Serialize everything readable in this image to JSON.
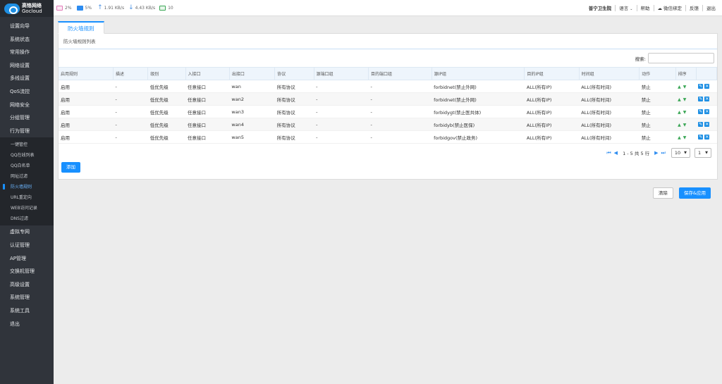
{
  "brand": {
    "name_cn": "高恪网络",
    "name_en": "Gocloud"
  },
  "sidebar": {
    "items_top": [
      {
        "label": "设置向导",
        "icon": "wizard-icon"
      },
      {
        "label": "系统状态",
        "icon": "status-icon"
      },
      {
        "label": "常用操作",
        "icon": "operations-icon"
      },
      {
        "label": "网络设置",
        "icon": "network-icon"
      },
      {
        "label": "多线设置",
        "icon": "multiline-icon"
      },
      {
        "label": "QoS流控",
        "icon": "qos-icon"
      },
      {
        "label": "网络安全",
        "icon": "security-icon"
      },
      {
        "label": "分组管理",
        "icon": "group-icon"
      },
      {
        "label": "行为管理",
        "icon": "behavior-icon"
      }
    ],
    "submenu": [
      {
        "label": "一键管控",
        "active": false
      },
      {
        "label": "QQ在线列表",
        "active": false
      },
      {
        "label": "QQ白名单",
        "active": false
      },
      {
        "label": "网址过滤",
        "active": false
      },
      {
        "label": "防火墙规则",
        "active": true
      },
      {
        "label": "URL重定向",
        "active": false
      },
      {
        "label": "WEB访问记录",
        "active": false
      },
      {
        "label": "DNS过滤",
        "active": false
      }
    ],
    "items_bottom": [
      {
        "label": "虚拟专网",
        "icon": "vpn-icon"
      },
      {
        "label": "认证管理",
        "icon": "auth-icon"
      },
      {
        "label": "AP管理",
        "icon": "ap-icon"
      },
      {
        "label": "交换机管理",
        "icon": "switch-icon"
      },
      {
        "label": "高级设置",
        "icon": "advanced-icon"
      },
      {
        "label": "系统管理",
        "icon": "system-icon"
      },
      {
        "label": "系统工具",
        "icon": "tools-icon"
      },
      {
        "label": "退出",
        "icon": "exit-icon"
      }
    ]
  },
  "topbar": {
    "cpu": "2%",
    "mem": "5%",
    "upload": "1.91 KB/s",
    "download": "4.43 KB/s",
    "devices": "10",
    "org": "普宁卫生院",
    "language": "语言",
    "help": "帮助",
    "wechat": "微信绑定",
    "feedback": "反馈",
    "logout": "退出"
  },
  "main": {
    "tab": "防火墙规则",
    "panel_title": "防火墙规则列表",
    "search_label": "搜索:",
    "search_placeholder": "",
    "columns": [
      "启用规则",
      "描述",
      "级别",
      "入接口",
      "出接口",
      "协议",
      "源端口组",
      "目的端口组",
      "源IP组",
      "目的IP组",
      "时间组",
      "动作",
      "排序",
      ""
    ],
    "rows": [
      {
        "enabled": "启用",
        "desc": "-",
        "level": "低优先级",
        "in": "任意接口",
        "out": "wan",
        "proto": "所有协议",
        "src_port": "-",
        "dst_port": "-",
        "src_ip": "forbidnet(禁止外网)",
        "dst_ip": "ALL(所有IP)",
        "time": "ALL(所有时间)",
        "action": "禁止"
      },
      {
        "enabled": "启用",
        "desc": "-",
        "level": "低优先级",
        "in": "任意接口",
        "out": "wan2",
        "proto": "所有协议",
        "src_port": "-",
        "dst_port": "-",
        "src_ip": "forbidnet(禁止外网)",
        "dst_ip": "ALL(所有IP)",
        "time": "ALL(所有时间)",
        "action": "禁止"
      },
      {
        "enabled": "启用",
        "desc": "-",
        "level": "低优先级",
        "in": "任意接口",
        "out": "wan3",
        "proto": "所有协议",
        "src_port": "-",
        "dst_port": "-",
        "src_ip": "forbidygt(禁止医共体)",
        "dst_ip": "ALL(所有IP)",
        "time": "ALL(所有时间)",
        "action": "禁止"
      },
      {
        "enabled": "启用",
        "desc": "-",
        "level": "低优先级",
        "in": "任意接口",
        "out": "wan4",
        "proto": "所有协议",
        "src_port": "-",
        "dst_port": "-",
        "src_ip": "forbidyb(禁止医保)",
        "dst_ip": "ALL(所有IP)",
        "time": "ALL(所有时间)",
        "action": "禁止"
      },
      {
        "enabled": "启用",
        "desc": "-",
        "level": "低优先级",
        "in": "任意接口",
        "out": "wan5",
        "proto": "所有协议",
        "src_port": "-",
        "dst_port": "-",
        "src_ip": "forbidgov(禁止政务)",
        "dst_ip": "ALL(所有IP)",
        "time": "ALL(所有时间)",
        "action": "禁止"
      }
    ],
    "pagination": {
      "text": "1 - 5 共 5 行",
      "page_size": "10",
      "page": "1"
    },
    "add_button": "添加",
    "clear_button": "清除",
    "save_button": "保存&应用"
  }
}
